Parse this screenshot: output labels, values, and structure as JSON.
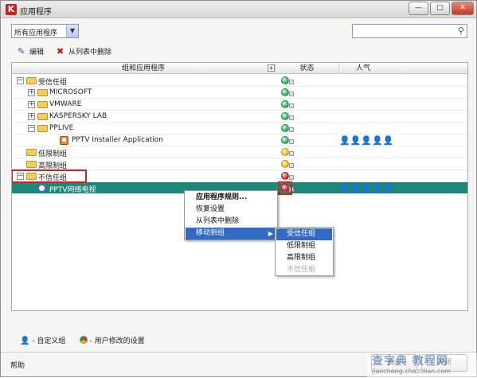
{
  "window": {
    "title": "应用程序",
    "logo": "K",
    "minimize_icon": "—",
    "maximize_icon": "□",
    "close_icon": "✕"
  },
  "filter": {
    "selected": "所有应用程序",
    "dropdown_icon": "▼"
  },
  "search": {
    "value": "",
    "icon": "⚲"
  },
  "toolbar": {
    "edit_icon": "✎",
    "edit_label": "编辑",
    "delete_icon": "✖",
    "delete_label": "从列表中删除"
  },
  "table": {
    "headers": {
      "name": "组和应用程序",
      "expand": "+",
      "status": "状态",
      "popularity": "人气"
    },
    "rows": [
      {
        "label": "受信任组",
        "expander": "−",
        "level": 0,
        "status": "green"
      },
      {
        "label": "MICROSOFT",
        "expander": "+",
        "level": 1,
        "status": "green"
      },
      {
        "label": "VMWARE",
        "expander": "+",
        "level": 1,
        "status": "green"
      },
      {
        "label": "KASPERSKY LAB",
        "expander": "+",
        "level": 1,
        "status": "green"
      },
      {
        "label": "PPLIVE",
        "expander": "−",
        "level": 1,
        "status": "green"
      },
      {
        "label": "PPTV Installer Application",
        "expander": "",
        "level": 2,
        "status": "green",
        "popularity": 2
      },
      {
        "label": "低限制组",
        "expander": "",
        "level": 0,
        "status": "yellow"
      },
      {
        "label": "高限制组",
        "expander": "",
        "level": 0,
        "status": "yellow"
      },
      {
        "label": "不信任组",
        "expander": "−",
        "level": 0,
        "status": "red"
      },
      {
        "label": "PPTV网络电视",
        "expander": "",
        "level": 1,
        "status": "red",
        "popularity": 5,
        "selected": true
      }
    ]
  },
  "context_menu": {
    "items": [
      {
        "label": "应用程序规则...",
        "bold": true
      },
      {
        "label": "恢复设置"
      },
      {
        "label": "从列表中删除"
      },
      {
        "label": "移动到组",
        "highlighted": true,
        "submenu_icon": "▶"
      }
    ]
  },
  "submenu": {
    "items": [
      {
        "label": "受信任组",
        "highlighted": true
      },
      {
        "label": "低限制组"
      },
      {
        "label": "高限制组"
      },
      {
        "label": "不信任组",
        "disabled": true
      }
    ]
  },
  "legend": {
    "custom_group_icon": "👤",
    "custom_group": "- 自定义组",
    "user_modified": "- 用户修改的设置"
  },
  "footer": {
    "help": "帮助",
    "ok": "确定",
    "close": "关闭"
  },
  "watermark": {
    "main": "查字典 教程网",
    "sub": "jiaocheng.chazidian.com"
  },
  "colors": {
    "selection": "#1f8778",
    "menu_highlight": "#306ac5",
    "annotation": "#d42020",
    "status_green": "#39b66a",
    "status_yellow": "#f0c51a",
    "status_red": "#e13030"
  }
}
